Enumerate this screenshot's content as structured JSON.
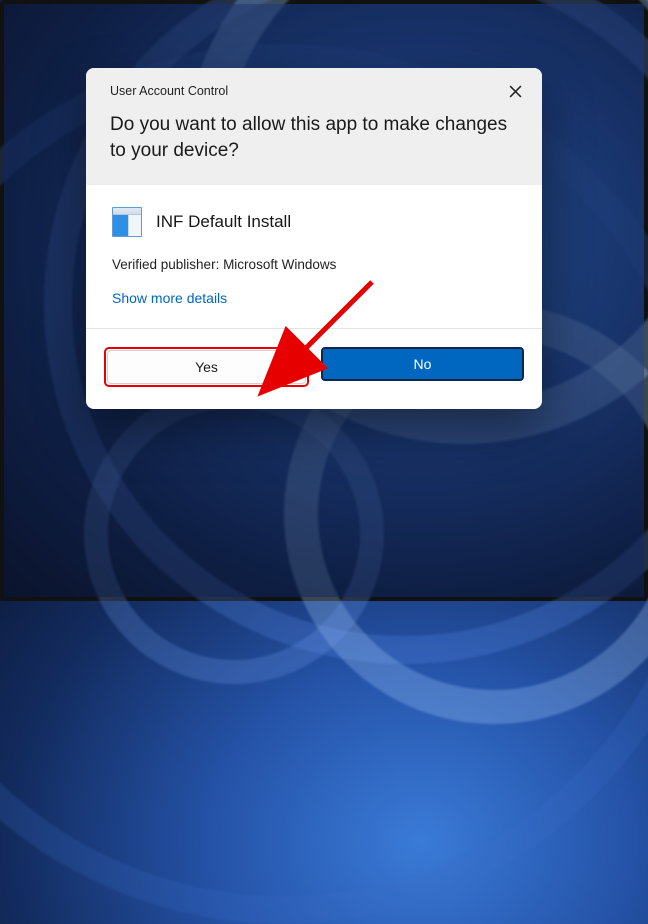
{
  "dialog": {
    "title": "User Account Control",
    "prompt": "Do you want to allow this app to make changes to your device?",
    "app_name": "INF Default Install",
    "publisher_line": "Verified publisher: Microsoft Windows",
    "details_link": "Show more details",
    "yes_label": "Yes",
    "no_label": "No"
  }
}
